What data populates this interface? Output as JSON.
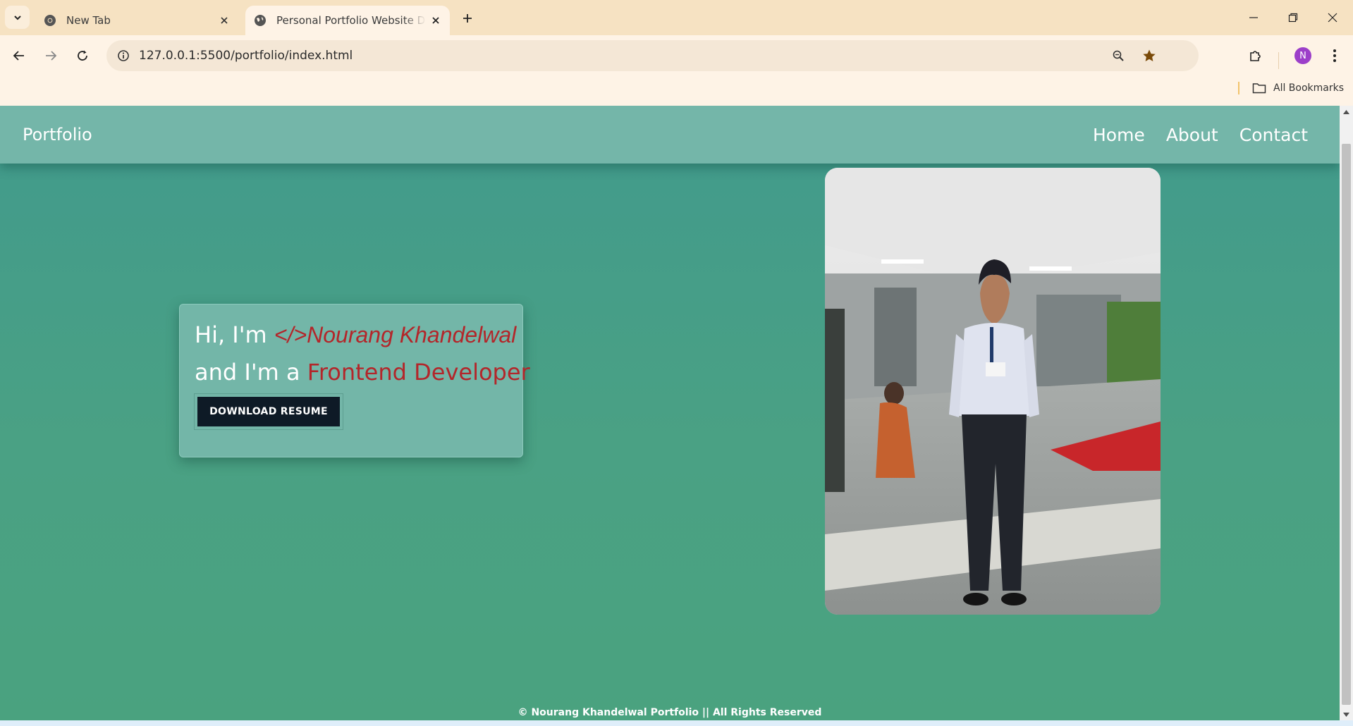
{
  "browser": {
    "tabs": [
      {
        "title": "New Tab",
        "favicon": "chrome-icon",
        "active": false
      },
      {
        "title": "Personal Portfolio Website Design",
        "favicon": "globe-icon",
        "active": true
      }
    ],
    "url": "127.0.0.1:5500/portfolio/index.html",
    "profile_initial": "N",
    "bookmarks_label": "All Bookmarks",
    "accent_color": "#f6e2c2",
    "avatar_color": "#9c3fc9"
  },
  "site": {
    "brand": "Portfolio",
    "nav": [
      "Home",
      "About",
      "Contact"
    ],
    "hero": {
      "greeting": "Hi, I'm ",
      "name": "</>Nourang Khandelwal",
      "role_prefix": "and I'm a ",
      "role": "Frontend Developer",
      "button_label": "DOWNLOAD RESUME"
    },
    "photo_alt": "portrait-photo",
    "footer": "© Nourang Khandelwal Portfolio || All Rights Reserved",
    "colors": {
      "header": "#74b6a9",
      "background": "#4aa184",
      "highlight": "#b3262a",
      "button": "#0e1a26"
    }
  }
}
